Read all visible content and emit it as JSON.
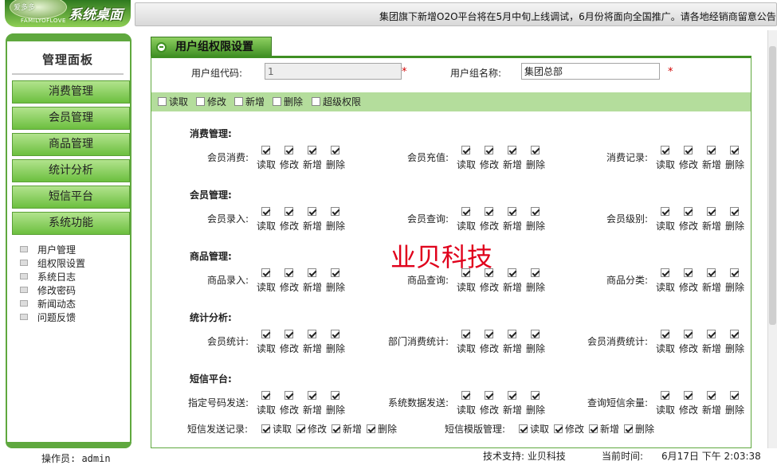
{
  "header": {
    "logo_badge": "爱多多",
    "logo_sub": "FAMILYOFLOVE",
    "logo_title": "系统桌面",
    "notice": "集团旗下新增O2O平台将在5月中旬上线调试，6月份将面向全国推广。请各地经销商留意公告"
  },
  "sidebar": {
    "title": "管理面板",
    "menu": [
      "消费管理",
      "会员管理",
      "商品管理",
      "统计分析",
      "短信平台",
      "系统功能"
    ],
    "sub_items": [
      "用户管理",
      "组权限设置",
      "系统日志",
      "修改密码",
      "新闻动态",
      "问题反馈"
    ]
  },
  "tab": {
    "label": "用户组权限设置"
  },
  "form": {
    "code_label": "用户组代码:",
    "code_value": "1",
    "name_label": "用户组名称:",
    "name_value": "集团总部",
    "star": "*"
  },
  "global_perms": [
    {
      "label": "读取",
      "checked": false
    },
    {
      "label": "修改",
      "checked": false
    },
    {
      "label": "新增",
      "checked": false
    },
    {
      "label": "删除",
      "checked": false
    },
    {
      "label": "超级权限",
      "checked": false
    }
  ],
  "perm_labels": [
    "读取",
    "修改",
    "新增",
    "删除"
  ],
  "sections": [
    {
      "title": "消费管理:",
      "items": [
        "会员消费:",
        "会员充值:",
        "消费记录:"
      ]
    },
    {
      "title": "会员管理:",
      "items": [
        "会员录入:",
        "会员查询:",
        "会员级别:"
      ]
    },
    {
      "title": "商品管理:",
      "items": [
        "商品录入:",
        "商品查询:",
        "商品分类:"
      ]
    },
    {
      "title": "统计分析:",
      "items": [
        "会员统计:",
        "部门消费统计:",
        "会员消费统计:"
      ]
    },
    {
      "title": "短信平台:",
      "items": [
        "指定号码发送:",
        "系统数据发送:",
        "查询短信余量:"
      ]
    }
  ],
  "extra_row": [
    {
      "label": "短信发送记录:"
    },
    {
      "label": "短信模版管理:"
    }
  ],
  "watermark": "业贝科技",
  "footer": {
    "operator": "操作员: admin",
    "support": "技术支持: 业贝科技",
    "time_label": "当前时间:",
    "time_value": "6月17日 下午 2:03:38"
  }
}
